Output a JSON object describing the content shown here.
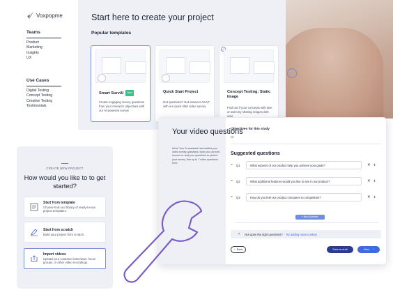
{
  "brand": {
    "name": "Voxpopme"
  },
  "nav": {
    "teams": {
      "heading": "Teams",
      "items": [
        "Product",
        "Marketing",
        "Insights",
        "UX"
      ]
    },
    "use_cases": {
      "heading": "Use Cases",
      "items": [
        "Digital Testing",
        "Concept Testing",
        "Creative Testing",
        "Testimonials"
      ]
    }
  },
  "main": {
    "title": "Start here to create your project",
    "subtitle": "Popular templates",
    "cards": [
      {
        "title": "Smart SurvAI",
        "badge": "New",
        "desc": "Create engaging survey questions from your research objectives with our AI-powered survey"
      },
      {
        "title": "Quick Start Project",
        "badge": "",
        "desc": "Got questions? Get answers ASAP with our quick-start video survey"
      },
      {
        "title": "Concept Testing: Static Image",
        "badge": "",
        "desc": "Find out if your concepts will raise or swim by sharing images with your"
      }
    ]
  },
  "start_panel": {
    "kicker": "CREATE NEW PROJECT",
    "question": "How would you like to to get started?",
    "options": [
      {
        "title": "Start from template",
        "desc": "Choose from our library of ready-to-use project templates."
      },
      {
        "title": "Start from scratch",
        "desc": "Build your project from scratch."
      },
      {
        "title": "Import videos",
        "desc": "Upload your customer interviews, focus groups, or other video recordings."
      }
    ]
  },
  "questions_panel": {
    "title": "Your video questions",
    "desc": "Wow! Your AI assistant has drafted your video survey questions. Now you can edit, remove or add your questions to perfect your survey. Aim up to 7 video questions here.",
    "objectives_label": "Objectives for this study",
    "objectives_value": "cit",
    "suggested_label": "Suggested questions",
    "questions": [
      {
        "num": "Q1",
        "text": "What aspects of our product help you achieve your goals?"
      },
      {
        "num": "Q2",
        "text": "What additional features would you like to see in our product?"
      },
      {
        "num": "Q3",
        "text": "How do you feel our product compares to competitors?"
      }
    ],
    "new_question_label": "+ New Question",
    "tip_text": "Not quite the right questions?",
    "tip_link": "Try adding more context",
    "back_label": "Back",
    "save_label": "Save as draft",
    "next_label": "Next"
  },
  "colors": {
    "accent": "#3e6be0",
    "panel": "#eef0f6",
    "dark_button": "#2a3c8f",
    "badge": "#3cc08a",
    "wrench": "#7b5cc7"
  }
}
